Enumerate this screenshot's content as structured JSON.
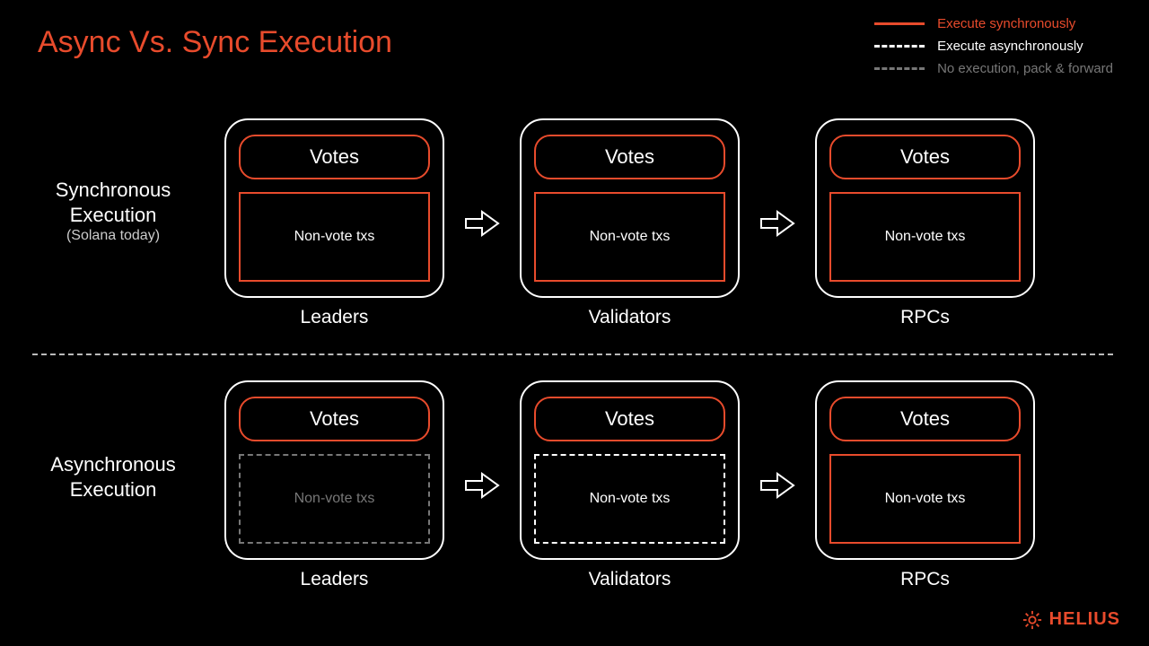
{
  "title": "Async Vs. Sync Execution",
  "legend": {
    "sync": "Execute synchronously",
    "async": "Execute asynchronously",
    "none": "No execution, pack & forward"
  },
  "sections": {
    "sync": {
      "label": "Synchronous Execution",
      "sublabel": "(Solana today)"
    },
    "async": {
      "label": "Asynchronous Execution"
    }
  },
  "boxes": {
    "votes": "Votes",
    "nonvote": "Non-vote txs"
  },
  "roles": {
    "leaders": "Leaders",
    "validators": "Validators",
    "rpcs": "RPCs"
  },
  "brand": "HELIUS"
}
